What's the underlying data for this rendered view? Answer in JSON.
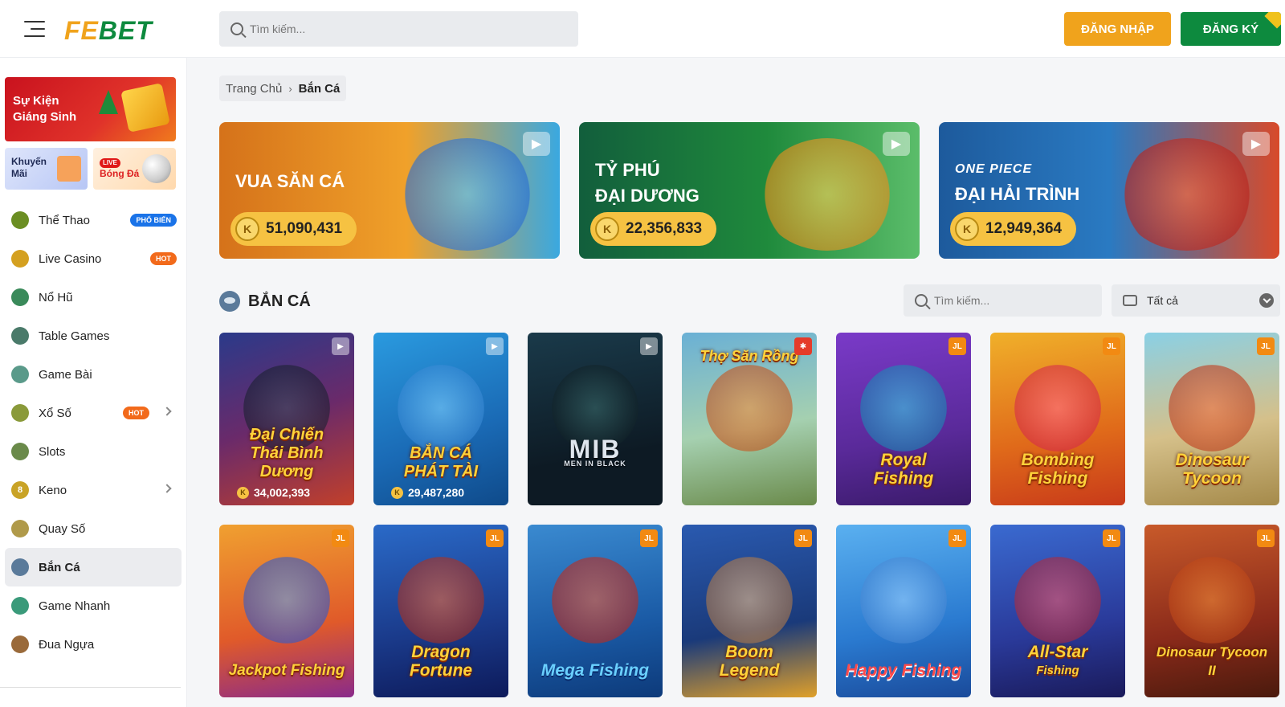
{
  "header": {
    "logo_fe": "FE",
    "logo_bet": "BET",
    "search_placeholder": "Tìm kiếm...",
    "login_label": "ĐĂNG NHẬP",
    "register_label": "ĐĂNG KÝ"
  },
  "sidebar": {
    "promo_main_line1": "Sự Kiện",
    "promo_main_line2": "Giáng Sinh",
    "promo_km_line1": "Khuyến",
    "promo_km_line2": "Mãi",
    "promo_bd_live": "LIVE",
    "promo_bd_label": "Bóng Đá",
    "items": [
      {
        "label": "Thể Thao",
        "badge": "PHỔ BIẾN"
      },
      {
        "label": "Live Casino",
        "badge": "HOT"
      },
      {
        "label": "Nổ Hũ"
      },
      {
        "label": "Table Games"
      },
      {
        "label": "Game Bài"
      },
      {
        "label": "Xổ Số",
        "badge": "HOT"
      },
      {
        "label": "Slots"
      },
      {
        "label": "Keno"
      },
      {
        "label": "Quay Số"
      },
      {
        "label": "Bắn Cá"
      },
      {
        "label": "Game Nhanh"
      },
      {
        "label": "Đua Ngựa"
      }
    ]
  },
  "breadcrumb": {
    "home": "Trang Chủ",
    "separator": "›",
    "current": "Bắn Cá"
  },
  "banners": [
    {
      "title_line1": "VUA SĂN CÁ",
      "jackpot": "51,090,431"
    },
    {
      "title_line1": "TỶ PHÚ",
      "title_line2": "ĐẠI DƯƠNG",
      "jackpot": "22,356,833"
    },
    {
      "brand": "ONE PIECE",
      "title_line1": "ĐẠI HẢI TRÌNH",
      "jackpot": "12,949,364"
    }
  ],
  "coin_symbol": "K",
  "section": {
    "title": "BẮN CÁ",
    "search_placeholder": "Tìm kiếm...",
    "filter_value": "Tất cả"
  },
  "provider_labels": {
    "jl": "JL"
  },
  "games": [
    {
      "name_line1": "Đại Chiến",
      "name_line2": "Thái Bình Dương",
      "jackpot": "34,002,393"
    },
    {
      "name_line1": "BẮN CÁ",
      "name_line2": "PHÁT TÀI",
      "jackpot": "29,487,280"
    },
    {
      "name_line1": "MIB",
      "name_line2": "MEN IN BLACK"
    },
    {
      "name_line1": "Thợ Săn Rồng"
    },
    {
      "name_line1": "Royal",
      "name_line2": "Fishing"
    },
    {
      "name_line1": "Bombing",
      "name_line2": "Fishing"
    },
    {
      "name_line1": "Dinosaur",
      "name_line2": "Tycoon"
    },
    {
      "name_line1": "Jackpot Fishing"
    },
    {
      "name_line1": "Dragon",
      "name_line2": "Fortune"
    },
    {
      "name_line1": "Mega Fishing"
    },
    {
      "name_line1": "Boom",
      "name_line2": "Legend"
    },
    {
      "name_line1": "Happy Fishing"
    },
    {
      "name_line1": "All-Star",
      "name_line2": "Fishing"
    },
    {
      "name_line1": "Dinosaur Tycoon",
      "name_line2": "II"
    }
  ],
  "colors": {
    "brand_orange": "#f0a31c",
    "brand_green": "#0d8a3e",
    "hot_badge": "#f26a1b",
    "popular_badge": "#1a73e8"
  }
}
